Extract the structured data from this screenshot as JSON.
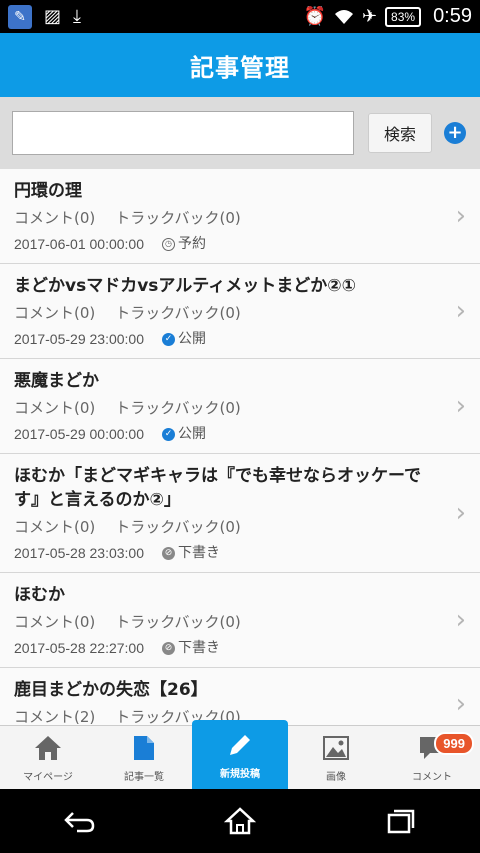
{
  "status_bar": {
    "battery": "83%",
    "time": "0:59"
  },
  "header": {
    "title": "記事管理"
  },
  "search": {
    "value": "",
    "placeholder": "",
    "button_label": "検索"
  },
  "articles": [
    {
      "title": "円環の理",
      "comments": "コメント(0)",
      "trackbacks": "トラックバック(0)",
      "date": "2017-06-01 00:00:00",
      "status": "予約",
      "status_type": "scheduled"
    },
    {
      "title": "まどかvsマドカvsアルティメットまどか②①",
      "comments": "コメント(0)",
      "trackbacks": "トラックバック(0)",
      "date": "2017-05-29 23:00:00",
      "status": "公開",
      "status_type": "published"
    },
    {
      "title": "悪魔まどか",
      "comments": "コメント(0)",
      "trackbacks": "トラックバック(0)",
      "date": "2017-05-29 00:00:00",
      "status": "公開",
      "status_type": "published"
    },
    {
      "title": "ほむか「まどマギキャラは『でも幸せならオッケーです』と言えるのか②」",
      "comments": "コメント(0)",
      "trackbacks": "トラックバック(0)",
      "date": "2017-05-28 23:03:00",
      "status": "下書き",
      "status_type": "draft"
    },
    {
      "title": "ほむか",
      "comments": "コメント(0)",
      "trackbacks": "トラックバック(0)",
      "date": "2017-05-28 22:27:00",
      "status": "下書き",
      "status_type": "draft"
    },
    {
      "title": "鹿目まどかの失恋【26】",
      "comments": "コメント(2)",
      "trackbacks": "トラックバック(0)",
      "date": "",
      "status": "",
      "status_type": ""
    }
  ],
  "tabs": [
    {
      "label": "マイページ",
      "icon": "home-icon"
    },
    {
      "label": "記事一覧",
      "icon": "document-icon"
    },
    {
      "label": "新規投稿",
      "icon": "pencil-icon",
      "active": true
    },
    {
      "label": "画像",
      "icon": "image-icon"
    },
    {
      "label": "コメント",
      "icon": "comment-icon",
      "badge": "999"
    }
  ],
  "colors": {
    "primary": "#0d9be6",
    "badge": "#e8552a",
    "published": "#1a7ed6"
  }
}
